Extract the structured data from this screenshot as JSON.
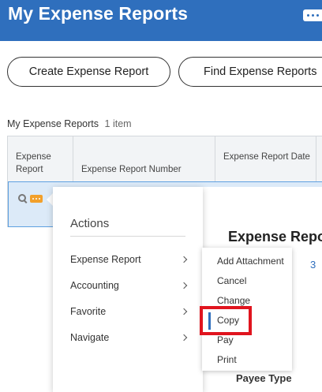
{
  "header": {
    "title": "My Expense Reports"
  },
  "buttons": {
    "create": "Create Expense Report",
    "find": "Find Expense Reports"
  },
  "list": {
    "label": "My Expense Reports",
    "count": "1 item"
  },
  "table": {
    "headers": [
      "Expense Report",
      "Expense Report Number",
      "Expense Report Date"
    ]
  },
  "actions": {
    "title": "Actions",
    "items": [
      "Expense Report",
      "Accounting",
      "Favorite",
      "Navigate"
    ]
  },
  "submenu": {
    "items": [
      "Add Attachment",
      "Cancel",
      "Change",
      "Copy",
      "Pay",
      "Print"
    ],
    "highlighted": "Copy"
  },
  "detail": {
    "title_partial": "Expense Repo",
    "link_partial": "3",
    "payee_label": "Payee Type"
  },
  "colors": {
    "header_bg": "#2f6fbd",
    "selection": "#dceaf8",
    "highlight": "#e0141e",
    "accent": "#f2a02b"
  }
}
